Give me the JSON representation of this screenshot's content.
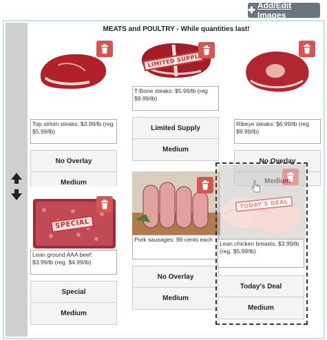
{
  "toolbar": {
    "add_edit_label": "Add/Edit Images",
    "add_icon": "plus-icon"
  },
  "panel": {
    "title": "MEATS and POULTRY - While quantities last!"
  },
  "colors": {
    "trash": "#d9534f",
    "stamp": "#c9302c",
    "handle": "#cfcfcf",
    "panel_border": "#bfe6ef"
  },
  "cards": [
    {
      "caption": "Top sirloin steaks: $3.99/lb (reg $5.99/lb)",
      "overlay": "No Overlay",
      "size": "Medium",
      "stamp": ""
    },
    {
      "caption": "T-Bone steaks: $5.99/lb (reg $9.99/lb)",
      "overlay": "Limited Supply",
      "size": "Medium",
      "stamp": "LIMITED SUPPL"
    },
    {
      "caption": "Ribeye steaks: $6.99/lb (reg $9.99/lb)",
      "overlay": "No Overlay",
      "size": "Medium",
      "stamp": ""
    },
    {
      "caption": "Lean ground AAA beef: $3.99/lb (reg. $4.99/lb)",
      "overlay": "Special",
      "size": "Medium",
      "stamp": "SPECIAL"
    },
    {
      "caption": "Pork sausages: 99 cents each",
      "overlay": "No Overlay",
      "size": "Medium",
      "stamp": ""
    },
    {
      "caption": "Lean chicken breasts: $3.99/lb (reg. $5.99/lb)",
      "overlay": "Today's Deal",
      "size": "Medium",
      "stamp": "TODAY'S DEAL"
    }
  ]
}
